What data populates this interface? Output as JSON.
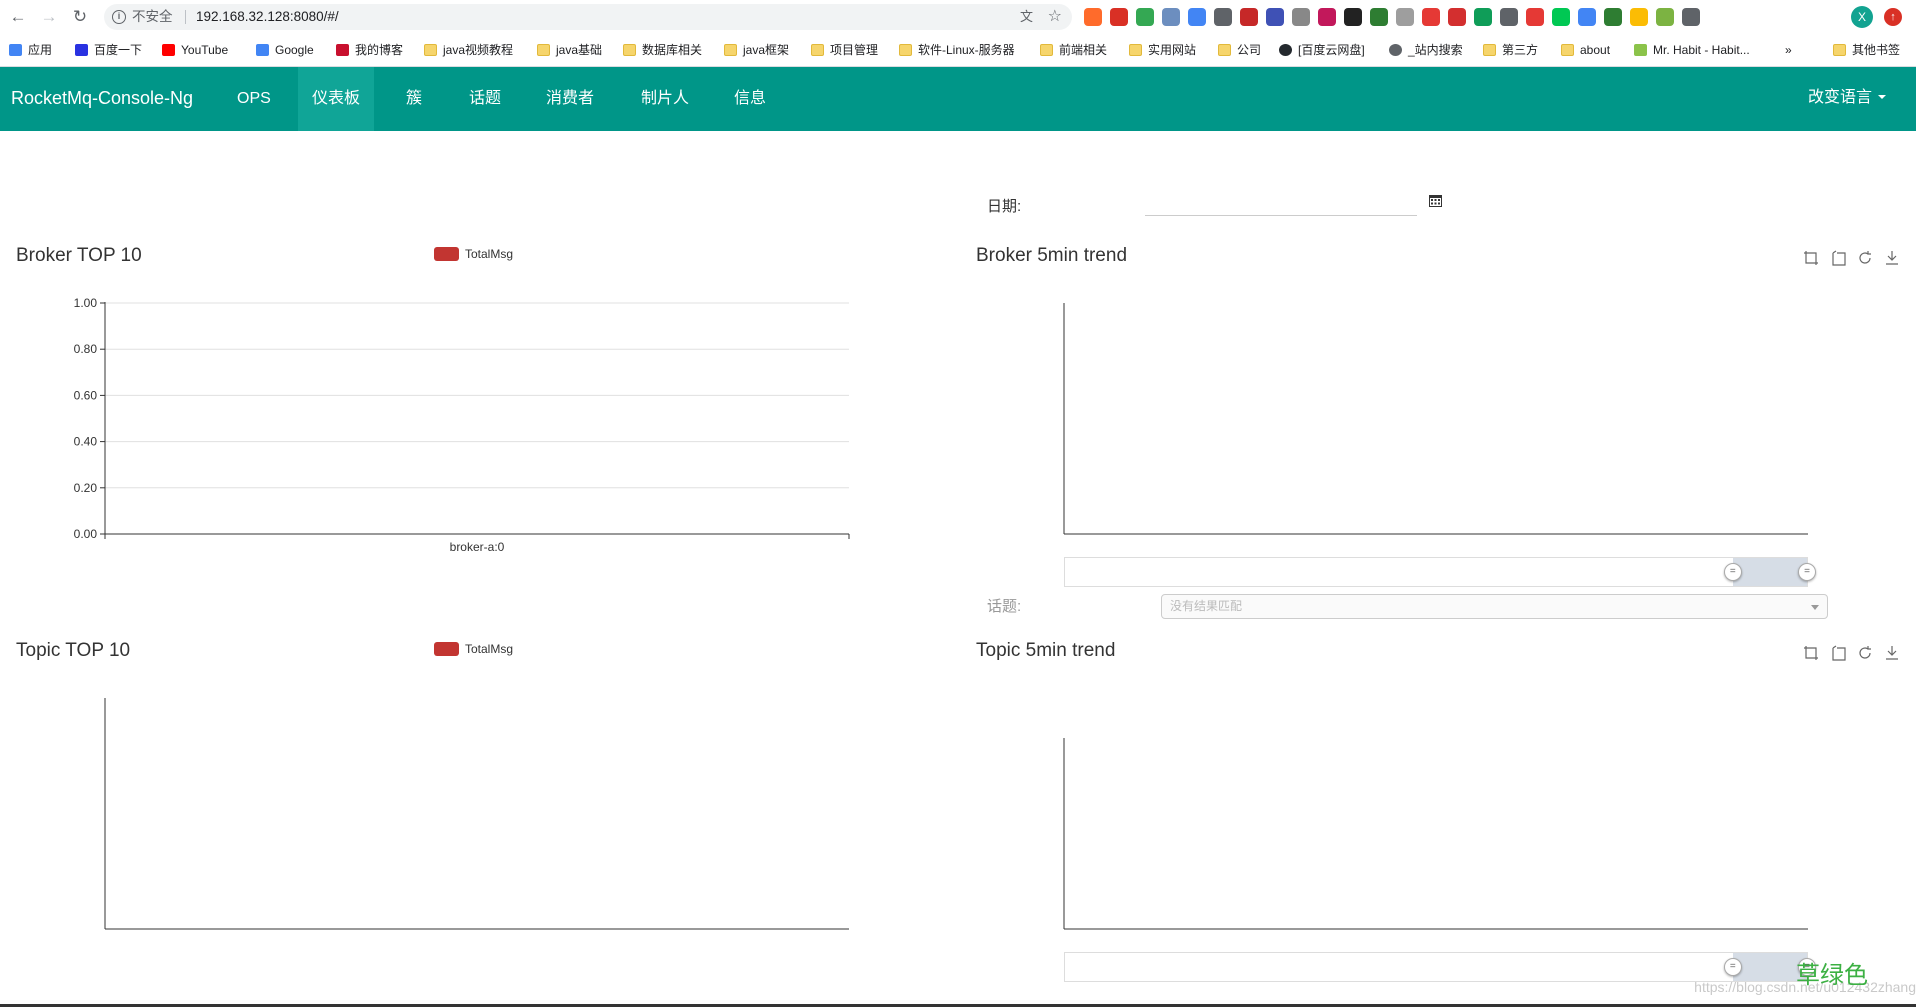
{
  "browser": {
    "security_text": "不安全",
    "url": "192.168.32.128:8080/#/",
    "extension_colors": [
      "#ff6b2b",
      "#d93025",
      "#34a853",
      "#6c8ebf",
      "#4285f4",
      "#5f6368",
      "#c62828",
      "#3f51b5",
      "#888888",
      "#c2185b",
      "#222222",
      "#2e7d32",
      "#9e9e9e",
      "#e53935",
      "#d32f2f",
      "#0f9d58",
      "#5f6368",
      "#e53935",
      "#00c853",
      "#4285f4",
      "#2e7d32",
      "#fbbc04",
      "#7cb342",
      "#5f6368"
    ],
    "profile_initial": "X",
    "bookmarks": [
      {
        "label": "应用",
        "icon": "apps-grid-icon"
      },
      {
        "label": "百度一下",
        "icon": "baidu-icon"
      },
      {
        "label": "YouTube",
        "icon": "youtube-icon"
      },
      {
        "label": "Google",
        "icon": "google-icon"
      },
      {
        "label": "我的博客",
        "icon": "csdn-icon"
      },
      {
        "label": "java视频教程",
        "icon": "folder-icon"
      },
      {
        "label": "java基础",
        "icon": "folder-icon"
      },
      {
        "label": "数据库相关",
        "icon": "folder-icon"
      },
      {
        "label": "java框架",
        "icon": "folder-icon"
      },
      {
        "label": "项目管理",
        "icon": "folder-icon"
      },
      {
        "label": "软件-Linux-服务器",
        "icon": "folder-icon"
      },
      {
        "label": "前端相关",
        "icon": "folder-icon"
      },
      {
        "label": "实用网站",
        "icon": "folder-icon"
      },
      {
        "label": "公司",
        "icon": "folder-icon"
      },
      {
        "label": "[百度云网盘]",
        "icon": "github-icon"
      },
      {
        "label": "_站内搜索",
        "icon": "globe-icon"
      },
      {
        "label": "第三方",
        "icon": "folder-icon"
      },
      {
        "label": "about",
        "icon": "folder-icon"
      },
      {
        "label": "Mr. Habit - Habit...",
        "icon": "habit-icon"
      }
    ],
    "more_bookmarks": "»",
    "other_bookmarks": "其他书签"
  },
  "navbar": {
    "brand": "RocketMq-Console-Ng",
    "items": [
      {
        "label": "OPS",
        "active": false
      },
      {
        "label": "仪表板",
        "active": true
      },
      {
        "label": "簇",
        "active": false
      },
      {
        "label": "话题",
        "active": false
      },
      {
        "label": "消费者",
        "active": false
      },
      {
        "label": "制片人",
        "active": false
      },
      {
        "label": "信息",
        "active": false
      }
    ],
    "language": "改变语言",
    "color": "#009688"
  },
  "filters": {
    "date_label": "日期:",
    "date_value": "",
    "topic_label": "话题:",
    "topic_placeholder": "没有结果匹配"
  },
  "panels": {
    "broker_top": {
      "title": "Broker TOP 10",
      "legend": "TotalMsg"
    },
    "broker_trend": {
      "title": "Broker 5min trend"
    },
    "topic_top": {
      "title": "Topic TOP 10",
      "legend": "TotalMsg"
    },
    "topic_trend": {
      "title": "Topic 5min trend"
    }
  },
  "chart_data": [
    {
      "type": "bar",
      "title": "Broker TOP 10",
      "categories": [
        "broker-a:0"
      ],
      "series": [
        {
          "name": "TotalMsg",
          "values": [
            0
          ]
        }
      ],
      "ylim": [
        0,
        1
      ],
      "yticks": [
        "0.00",
        "0.20",
        "0.40",
        "0.60",
        "0.80",
        "1.00"
      ],
      "grid": true,
      "legend": "top-center",
      "color": "#c23531"
    },
    {
      "type": "line",
      "title": "Broker 5min trend",
      "series": [],
      "grid": false,
      "zoom_range": [
        0.9,
        1.0
      ]
    },
    {
      "type": "bar",
      "title": "Topic TOP 10",
      "categories": [],
      "series": [
        {
          "name": "TotalMsg",
          "values": []
        }
      ],
      "grid": false,
      "legend": "top-center",
      "color": "#c23531"
    },
    {
      "type": "line",
      "title": "Topic 5min trend",
      "series": [],
      "grid": false,
      "zoom_range": [
        0.9,
        1.0
      ]
    }
  ],
  "overlay": {
    "watermark": "https://blog.csdn.net/u012432zhang",
    "green_text": "草绿色"
  }
}
